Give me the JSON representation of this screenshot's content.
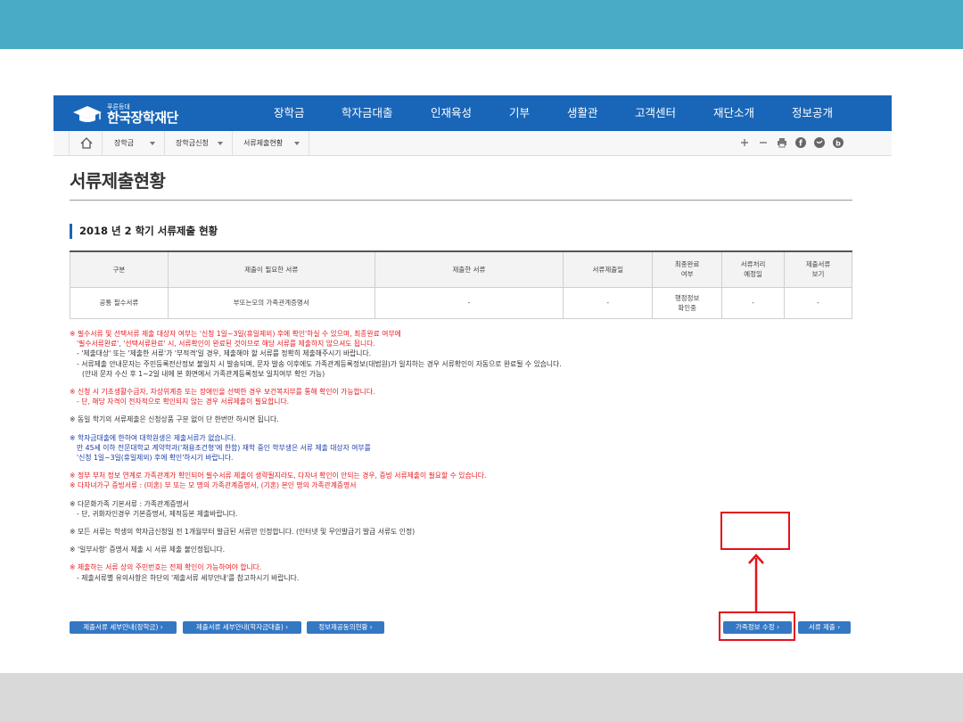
{
  "header": {
    "logo_small": "푸른등대",
    "logo_name": "한국장학재단",
    "nav": [
      "장학금",
      "학자금대출",
      "인재육성",
      "기부",
      "생활관",
      "고객센터",
      "재단소개",
      "정보공개"
    ]
  },
  "breadcrumb": [
    "장학금",
    "장학금신청",
    "서류제출현황"
  ],
  "tools": [
    "plus-icon",
    "minus-icon",
    "print-icon",
    "facebook-icon",
    "twitter-icon",
    "blog-icon"
  ],
  "page_title": "서류제출현황",
  "section_title": "2018 년 2 학기 서류제출 현황",
  "table": {
    "headers": [
      "구분",
      "제출이 필요한 서류",
      "제출한 서류",
      "서류제출일",
      "최종완료\n여부",
      "서류처리\n예정일",
      "제출서류\n보기"
    ],
    "rows": [
      [
        "공통 필수서류",
        "부또는모의 가족관계증명서",
        "-",
        "-",
        "행정정보\n확인중",
        "-",
        "-"
      ]
    ]
  },
  "notes": {
    "n1_red_1": "※ 필수서류 및 선택서류 제출 대상자 여부는 '신청 1일~3일(휴일제외) 후에 확인'하실 수 있으며, 최종완료 여부에",
    "n1_red_2": "'필수서류완료', '선택서류완료' 시, 서류확인이 완료된 것이므로 해당 서류를 제출하지 않으셔도 됩니다.",
    "n1_dark_1": "- '제출대상' 또는 '제출한 서류'가 '부적격'일 경우, 제출해야 할 서류를 정확히 제출해주시기 바랍니다.",
    "n1_dark_2": "- 서류제출 안내문자는 주민등록전산정보 불일치 시 발송되며, 문자 발송 이후에도 가족관계등록정보(대법원)가 일치하는 경우 서류확인이 자동으로 완료될 수 있습니다.",
    "n1_dark_3": "(안내 문자 수신 후 1~2일 내에 본 화면에서 가족관계등록정보 일치여부 확인 가능)",
    "n2_red_1": "※ 신청 시 기초생활수급자, 차상위계층 또는 장애인을 선택한 경우 보건복지부를 통해 확인이 가능합니다.",
    "n2_red_2": "- 단, 해당 자격이 전자적으로 확인되지 않는 경우 서류제출이 필요합니다.",
    "n3_dark": "※ 동일 학기의 서류제출은 신청상품 구분 없이 단 한번만 하시면 됩니다.",
    "n4_blue_1": "※ 학자금대출에 한하여 대학원생은 제출서류가 없습니다.",
    "n4_blue_2": "만 45세 이하 전문대학교 계약학과('채용조건형'에 한함) 재학 중인 학부생은 서류 제출 대상자 여부를",
    "n4_blue_3": "'신청 1일~3일(휴일제외) 후에 확인'하시기 바랍니다.",
    "n5_red_1": "※ 정부 부처 정보 연계로 가족관계가 확인되어 필수서류 제출이 생략될지라도, 다자녀 확인이 안되는 경우, 증빙 서류제출이 필요할 수 있습니다.",
    "n5_red_2": "※ 다자녀가구 증빙서류 : (미혼) 부 또는 모 명의 가족관계증명서, (기혼) 본인 명의 가족관계증명서",
    "n6_dark_1": "※ 다문화가족 기본서류 : 가족관계증명서",
    "n6_dark_2": "- 단, 귀화자인경우 기본증명서, 제적등본 제출바랍니다.",
    "n7_dark": "※ 모든 서류는 학생의 학자금신청일 전 1개월부터 발급된 서류만 인정합니다. (인터넷 및 무인발급기 발급 서류도 인정)",
    "n8_dark": "※ '일부사항' 증명서 제출 시 서류 제출 불인정됩니다.",
    "n9_red": "※ 제출하는 서류 상의 주민번호는 전체 확인이 가능하여야 합니다.",
    "n9_dark": "- 제출서류별 유의사항은 하단의 '제출서류 세부안내'를 참고하시기 바랍니다."
  },
  "buttons": {
    "b1": "제출서류 세부안내(장학금) ›",
    "b2": "제출서류 세부안내(학자금대출) ›",
    "b3": "정보제공동의현황 ›",
    "b4": "가족정보 수정 ›",
    "b5": "서류 제출 ›"
  },
  "colors": {
    "top_band": "#4aabc6",
    "header": "#1966b8",
    "button": "#3478c4",
    "annotation": "#e3121b"
  }
}
